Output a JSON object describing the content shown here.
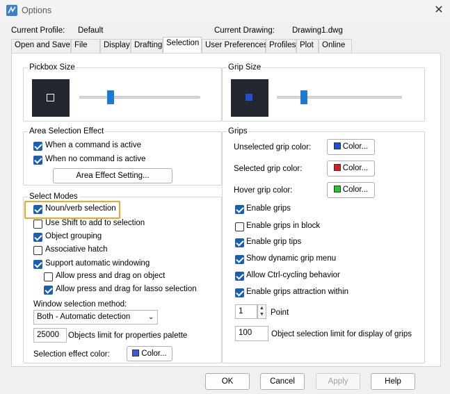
{
  "window": {
    "title": "Options"
  },
  "profile": {
    "label": "Current Profile:",
    "value": "Default"
  },
  "drawing": {
    "label": "Current Drawing:",
    "value": "Drawing1.dwg"
  },
  "tabs": [
    "Open and Save",
    "File",
    "Display",
    "Drafting",
    "Selection",
    "User Preferences",
    "Profiles",
    "Plot",
    "Online"
  ],
  "active_tab": "Selection",
  "pickbox": {
    "title": "Pickbox Size",
    "level_fraction": 0.27
  },
  "grip_size": {
    "title": "Grip Size",
    "level_fraction": 0.25
  },
  "area_selection": {
    "title": "Area Selection Effect",
    "when_active": "When a command is active",
    "when_no_command": "When no command is active",
    "setting_button": "Area Effect Setting..."
  },
  "select_modes": {
    "title": "Select Modes",
    "noun_verb": "Noun/verb selection",
    "use_shift": "Use Shift to add to selection",
    "object_grouping": "Object grouping",
    "associative_hatch": "Associative hatch",
    "auto_windowing": "Support automatic windowing",
    "press_drag_object": "Allow press and drag on object",
    "press_drag_lasso": "Allow press and drag for lasso selection",
    "window_method_label": "Window selection method:",
    "window_method_value": "Both - Automatic detection",
    "objects_limit_value": "25000",
    "objects_limit_label": "Objects limit for properties palette",
    "effect_color_label": "Selection effect color:",
    "color_button": "Color..."
  },
  "grips": {
    "title": "Grips",
    "unselected_label": "Unselected grip color:",
    "selected_label": "Selected grip color:",
    "hover_label": "Hover grip color:",
    "color_button": "Color...",
    "enable_grips": "Enable grips",
    "enable_in_block": "Enable grips in block",
    "enable_tips": "Enable grip tips",
    "dynamic_menu": "Show dynamic grip menu",
    "ctrl_cycling": "Allow Ctrl-cycling behavior",
    "attraction": "Enable grips attraction within",
    "point_value": "1",
    "point_label": "Point",
    "limit_value": "100",
    "limit_label": "Object selection limit for display of grips"
  },
  "colors": {
    "selection_effect": "#3b5bdb",
    "unselected": "#1e4fd8",
    "selected": "#e01b1b",
    "hover": "#22cc22",
    "grip_preview": "#1e4fd8",
    "highlight": "#f5a623"
  },
  "buttons": {
    "ok": "OK",
    "cancel": "Cancel",
    "apply": "Apply",
    "help": "Help"
  }
}
